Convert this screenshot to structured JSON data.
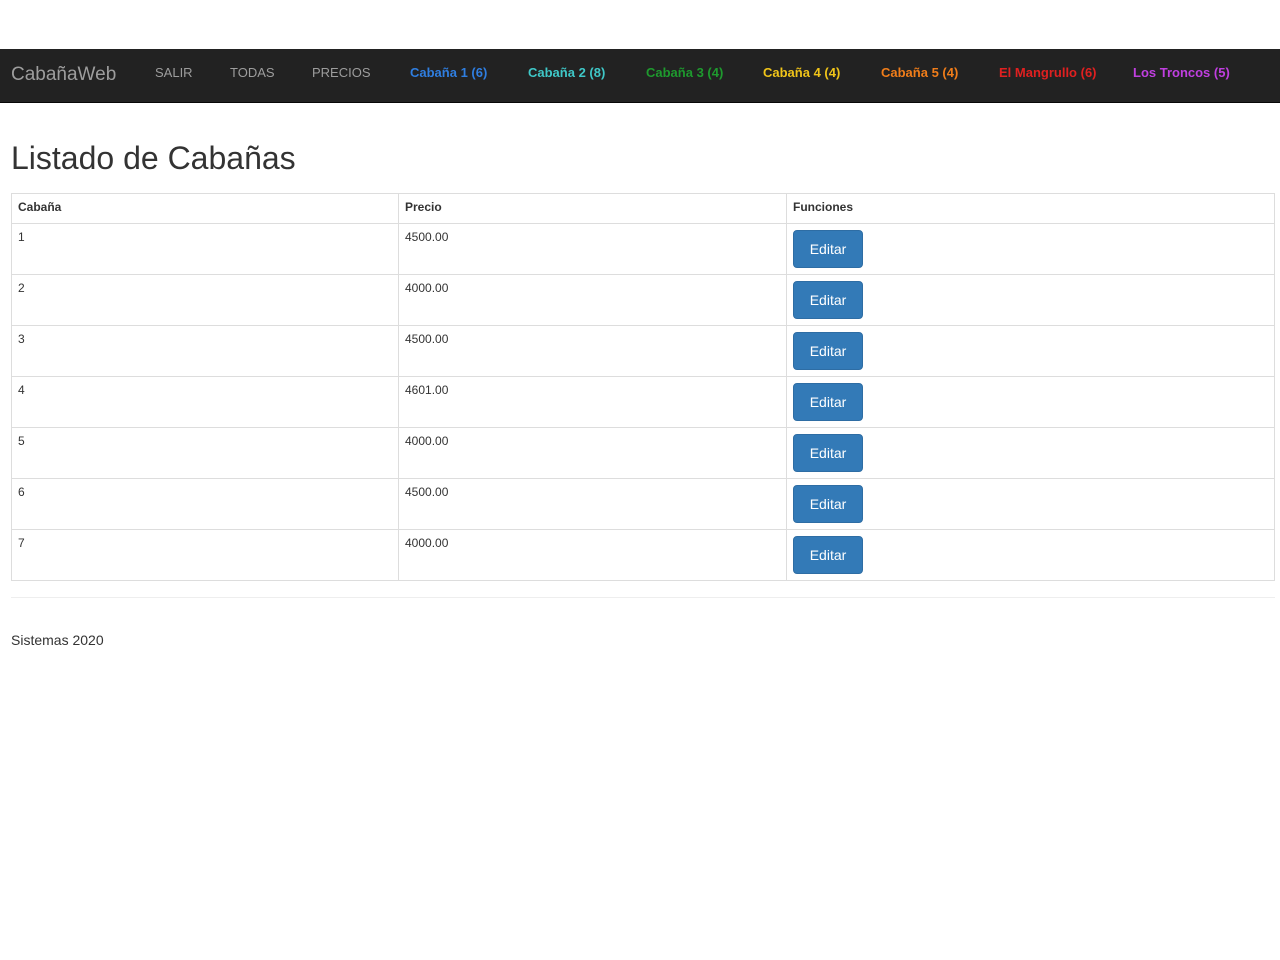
{
  "navbar": {
    "brand": "CabañaWeb",
    "items": [
      {
        "label": "SALIR",
        "color": "#9d9d9d"
      },
      {
        "label": "TODAS",
        "color": "#9d9d9d"
      },
      {
        "label": "PRECIOS",
        "color": "#9d9d9d"
      },
      {
        "label": "Cabaña 1 (6)",
        "color": "#2f7ee0"
      },
      {
        "label": "Cabaña 2 (8)",
        "color": "#3fc8c8"
      },
      {
        "label": "Cabaña 3 (4)",
        "color": "#1e9a2e"
      },
      {
        "label": "Cabaña 4 (4)",
        "color": "#f0c419"
      },
      {
        "label": "Cabaña 5 (4)",
        "color": "#f07d1a"
      },
      {
        "label": "El Mangrullo (6)",
        "color": "#e02020"
      },
      {
        "label": "Los Troncos (5)",
        "color": "#c03fe0"
      }
    ]
  },
  "page": {
    "title": "Listado de Cabañas"
  },
  "table": {
    "headers": [
      "Cabaña",
      "Precio",
      "Funciones"
    ],
    "edit_label": "Editar",
    "rows": [
      {
        "cabana": "1",
        "precio": "4500.00"
      },
      {
        "cabana": "2",
        "precio": "4000.00"
      },
      {
        "cabana": "3",
        "precio": "4500.00"
      },
      {
        "cabana": "4",
        "precio": "4601.00"
      },
      {
        "cabana": "5",
        "precio": "4000.00"
      },
      {
        "cabana": "6",
        "precio": "4500.00"
      },
      {
        "cabana": "7",
        "precio": "4000.00"
      }
    ]
  },
  "footer": {
    "text": "Sistemas 2020"
  }
}
